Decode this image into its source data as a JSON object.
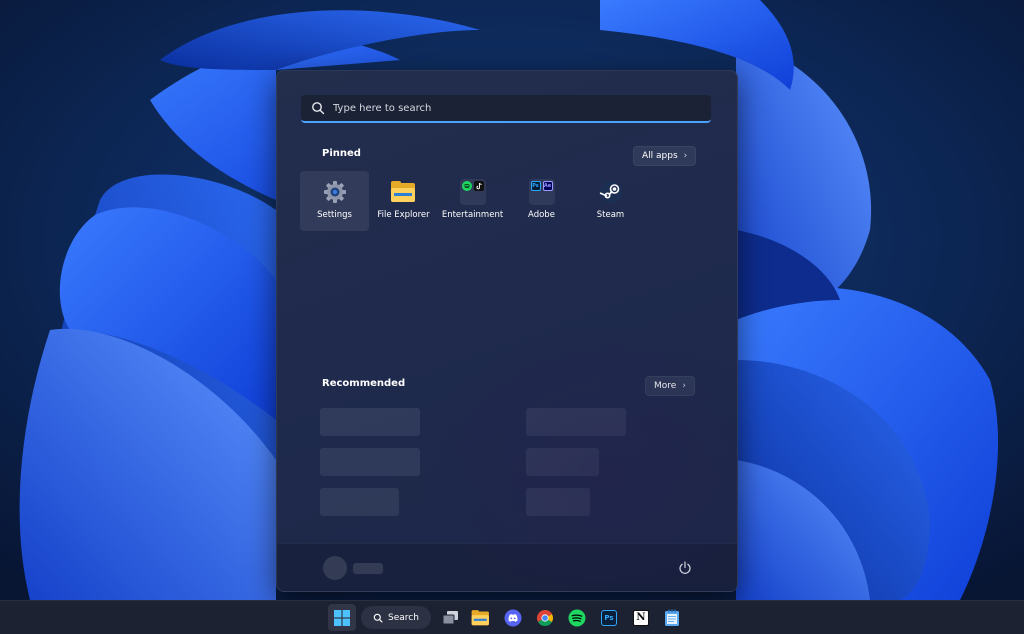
{
  "search": {
    "placeholder": "Type here to search"
  },
  "pinned": {
    "title": "Pinned",
    "all_apps_label": "All apps",
    "apps": [
      {
        "label": "Settings",
        "icon": "gear-icon"
      },
      {
        "label": "File Explorer",
        "icon": "folder-icon"
      },
      {
        "label": "Entertainment",
        "icon": "entertainment-folder-icon",
        "contains": [
          "spotify-icon",
          "tiktok-icon"
        ]
      },
      {
        "label": "Adobe",
        "icon": "adobe-folder-icon",
        "contains": [
          "photoshop-icon",
          "after-effects-icon"
        ]
      },
      {
        "label": "Steam",
        "icon": "steam-icon"
      }
    ]
  },
  "recommended": {
    "title": "Recommended",
    "more_label": "More"
  },
  "taskbar": {
    "search_label": "Search",
    "items": [
      "start-icon",
      "search-icon",
      "task-view-icon",
      "file-explorer-icon",
      "discord-icon",
      "chrome-icon",
      "spotify-icon",
      "photoshop-icon",
      "notion-icon",
      "notepad-icon"
    ],
    "ps_label": "Ps",
    "notion_label": "N"
  },
  "colors": {
    "accent": "#4aa3ff",
    "start_bg": "#1f2a4d",
    "taskbar_bg": "#1d2233",
    "spotify": "#1ed760",
    "discord": "#5865f2"
  }
}
